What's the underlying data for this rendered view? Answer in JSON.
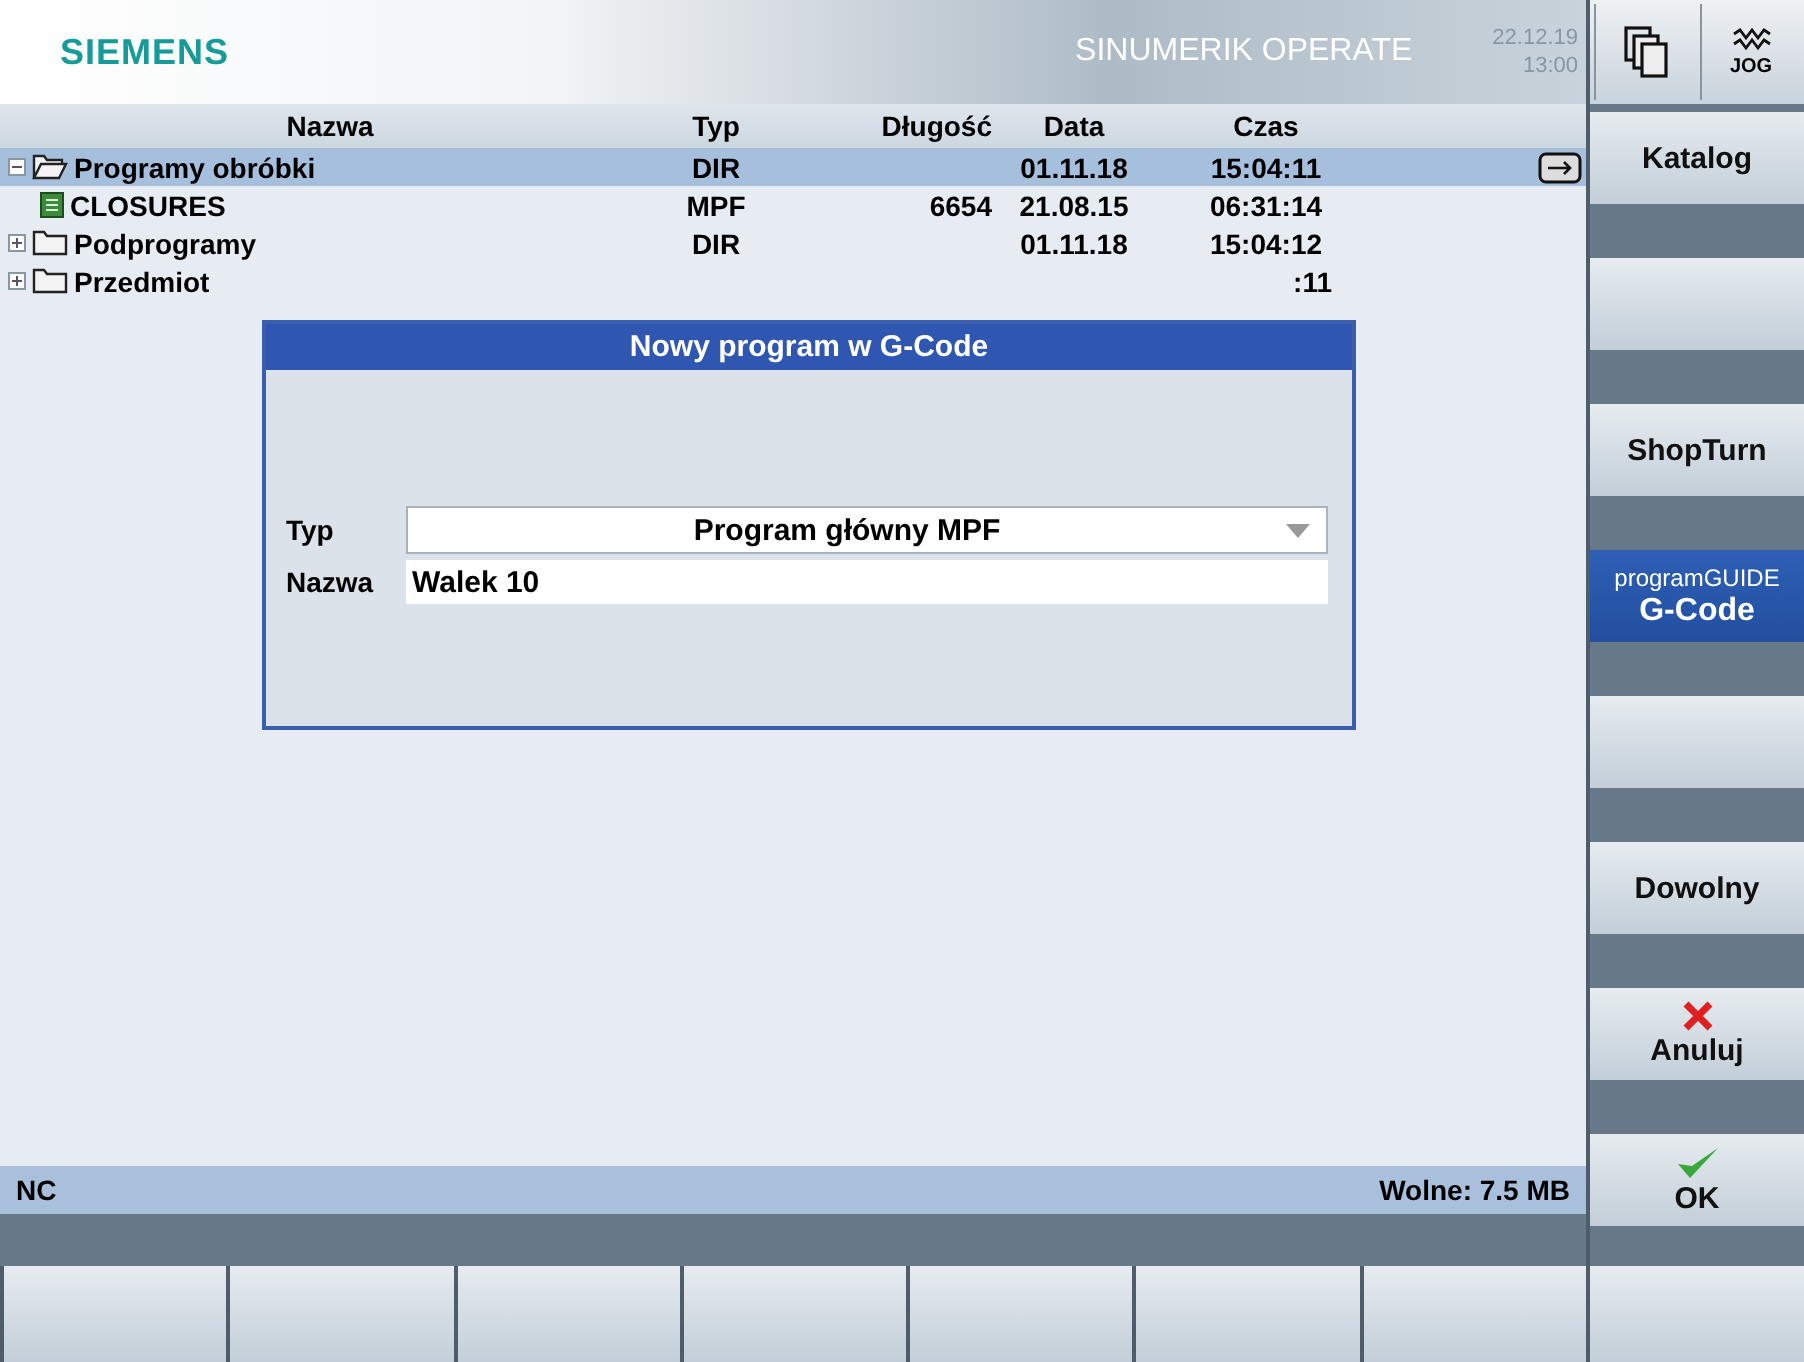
{
  "header": {
    "brand": "SIEMENS",
    "product": "SINUMERIK OPERATE",
    "date": "22.12.19",
    "time": "13:00",
    "mode": "JOG"
  },
  "table": {
    "columns": [
      "Nazwa",
      "Typ",
      "Długość",
      "Data",
      "Czas"
    ],
    "rows": [
      {
        "name": "Programy obróbki",
        "type": "DIR",
        "length": "",
        "date": "01.11.18",
        "time": "15:04:11",
        "kind": "folder",
        "expanded": true,
        "selected": true,
        "children": [
          {
            "name": "CLOSURES",
            "type": "MPF",
            "length": "6654",
            "date": "21.08.15",
            "time": "06:31:14",
            "kind": "file",
            "selected": false
          }
        ]
      },
      {
        "name": "Podprogramy",
        "type": "DIR",
        "length": "",
        "date": "01.11.18",
        "time": "15:04:12",
        "kind": "folder",
        "expanded": false,
        "selected": false
      },
      {
        "name": "Przedmiot",
        "type": "",
        "length": "",
        "date": "",
        "time": ":11",
        "kind": "folder",
        "expanded": false,
        "selected": false
      }
    ]
  },
  "dialog": {
    "title": "Nowy program w G-Code",
    "fields": [
      {
        "label": "Typ",
        "kind": "dropdown",
        "value": "Program główny MPF"
      },
      {
        "label": "Nazwa",
        "kind": "text",
        "value": "Walek 10"
      }
    ]
  },
  "status_bar": {
    "left": "NC",
    "right": "Wolne: 7.5 MB"
  },
  "softkeys": [
    {
      "kind": "text",
      "label": "Katalog",
      "selected": false
    },
    {
      "kind": "blank",
      "selected": false
    },
    {
      "kind": "text",
      "label": "ShopTurn",
      "selected": false
    },
    {
      "kind": "guide",
      "caption": "programGUIDE",
      "label": "G-Code",
      "selected": true
    },
    {
      "kind": "blank",
      "selected": false
    },
    {
      "kind": "text",
      "label": "Dowolny",
      "selected": false
    },
    {
      "kind": "cancel",
      "label": "Anuluj",
      "selected": false
    },
    {
      "kind": "ok",
      "label": "OK",
      "selected": false
    }
  ]
}
